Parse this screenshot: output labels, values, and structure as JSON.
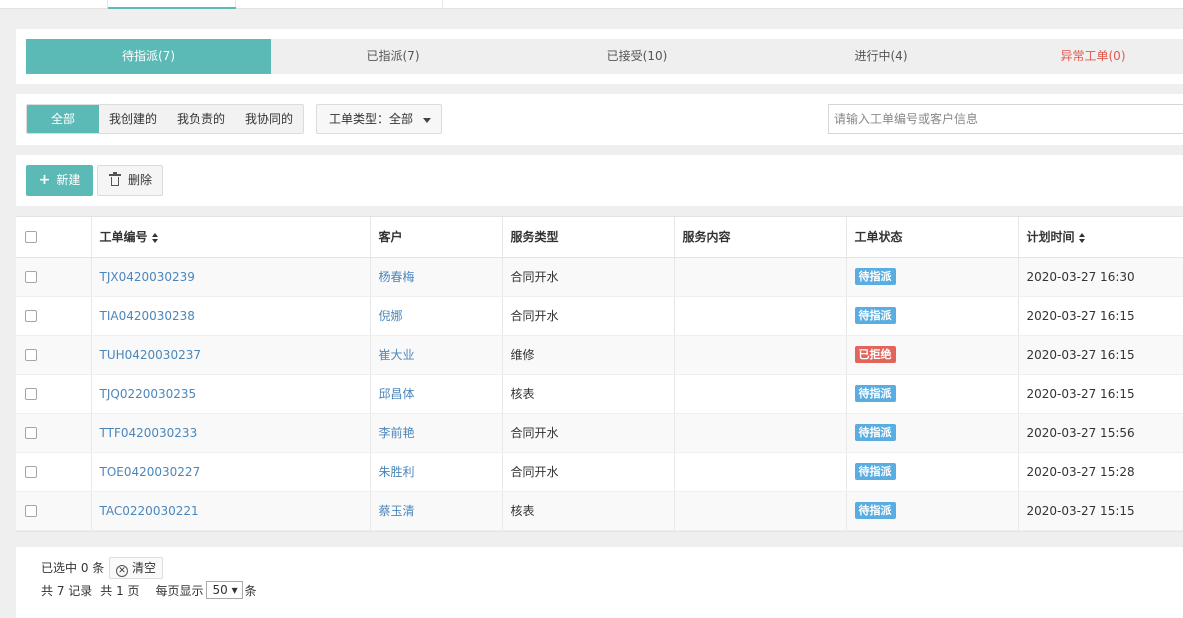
{
  "status_tabs": [
    {
      "label": "待指派(7)",
      "active": true,
      "width": 245
    },
    {
      "label": "已指派(7)",
      "active": false,
      "width": 244
    },
    {
      "label": "已接受(10)",
      "active": false,
      "width": 244
    },
    {
      "label": "进行中(4)",
      "active": false,
      "width": 244
    },
    {
      "label": "异常工单(0)",
      "active": false,
      "danger": true,
      "width": 180
    }
  ],
  "filter": {
    "scope_options": [
      "全部",
      "我创建的",
      "我负责的",
      "我协同的"
    ],
    "type_dropdown": "工单类型：全部",
    "search_placeholder": "请输入工单编号或客户信息"
  },
  "actions": {
    "new_label": "新建",
    "delete_label": "删除"
  },
  "table": {
    "headers": {
      "order_no": "工单编号",
      "customer": "客户",
      "service_type": "服务类型",
      "service_content": "服务内容",
      "status": "工单状态",
      "plan_time": "计划时间"
    },
    "rows": [
      {
        "order_no": "TJX0420030239",
        "customer": "杨春梅",
        "service_type": "合同开水",
        "service_content": "",
        "status": "待指派",
        "status_color": "blue",
        "plan_time": "2020-03-27 16:30"
      },
      {
        "order_no": "TIA0420030238",
        "customer": "倪娜",
        "service_type": "合同开水",
        "service_content": "",
        "status": "待指派",
        "status_color": "blue",
        "plan_time": "2020-03-27 16:15"
      },
      {
        "order_no": "TUH0420030237",
        "customer": "崔大业",
        "service_type": "维修",
        "service_content": "",
        "status": "已拒绝",
        "status_color": "red",
        "plan_time": "2020-03-27 16:15"
      },
      {
        "order_no": "TJQ0220030235",
        "customer": "邱昌体",
        "service_type": "核表",
        "service_content": "",
        "status": "待指派",
        "status_color": "blue",
        "plan_time": "2020-03-27 16:15"
      },
      {
        "order_no": "TTF0420030233",
        "customer": "李前艳",
        "service_type": "合同开水",
        "service_content": "",
        "status": "待指派",
        "status_color": "blue",
        "plan_time": "2020-03-27 15:56"
      },
      {
        "order_no": "TOE0420030227",
        "customer": "朱胜利",
        "service_type": "合同开水",
        "service_content": "",
        "status": "待指派",
        "status_color": "blue",
        "plan_time": "2020-03-27 15:28"
      },
      {
        "order_no": "TAC0220030221",
        "customer": "蔡玉清",
        "service_type": "核表",
        "service_content": "",
        "status": "待指派",
        "status_color": "blue",
        "plan_time": "2020-03-27 15:15"
      }
    ]
  },
  "footer": {
    "selected_text": "已选中 0 条",
    "clear_label": "清空",
    "total_records": "共 7 记录",
    "total_pages": "共 1 页",
    "per_page_label": "每页显示",
    "per_page_value": "50 ▾",
    "per_page_suffix": "条"
  },
  "colors": {
    "accent": "#5bbab6",
    "link": "#4b86bb",
    "badge_blue": "#5aade0",
    "badge_red": "#e2645a",
    "danger_text": "#e0594d"
  }
}
